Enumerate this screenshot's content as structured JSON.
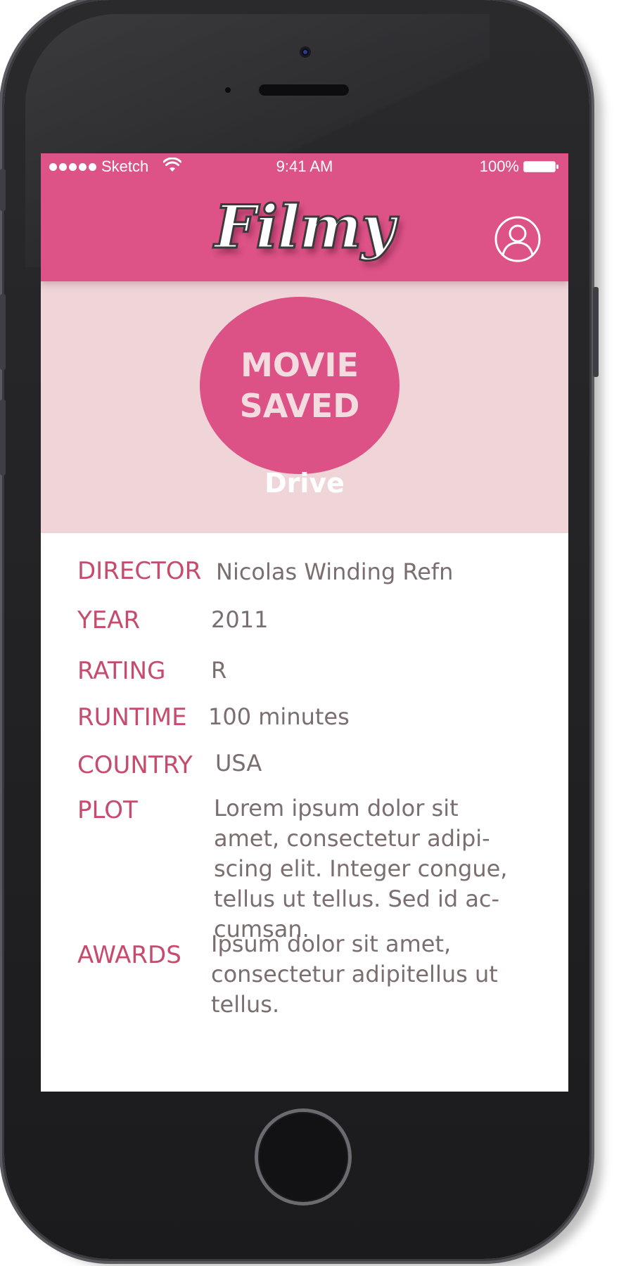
{
  "status_bar": {
    "carrier": "Sketch",
    "time": "9:41 AM",
    "battery": "100%"
  },
  "header": {
    "logo": "Filmy",
    "profile_icon": "user-circle-icon",
    "background_color": "#dd5287"
  },
  "hero": {
    "badge_line1": "MOVIE",
    "badge_line2": "SAVED",
    "movie_title": "Drive",
    "background_color": "#efd5d8",
    "badge_color": "#dc5186"
  },
  "details": {
    "director": {
      "label": "DIRECTOR",
      "value": "Nicolas Winding Refn"
    },
    "year": {
      "label": "YEAR",
      "value": "2011"
    },
    "rating": {
      "label": "RATING",
      "value": "R"
    },
    "runtime": {
      "label": "RUNTIME",
      "value": "100 minutes"
    },
    "country": {
      "label": "COUNTRY",
      "value": "USA"
    },
    "plot": {
      "label": "PLOT",
      "lines": [
        "Lorem ipsum dolor sit",
        "amet, consectetur adipi-",
        "scing elit. Integer congue,",
        "tellus ut tellus. Sed id ac-",
        "cumsan."
      ]
    },
    "awards": {
      "label": "AWARDS",
      "lines": [
        "Ipsum dolor sit amet,",
        "consectetur adipitellus ut",
        "tellus."
      ]
    },
    "label_color": "#c64b6d",
    "value_color": "#7b6e70"
  }
}
